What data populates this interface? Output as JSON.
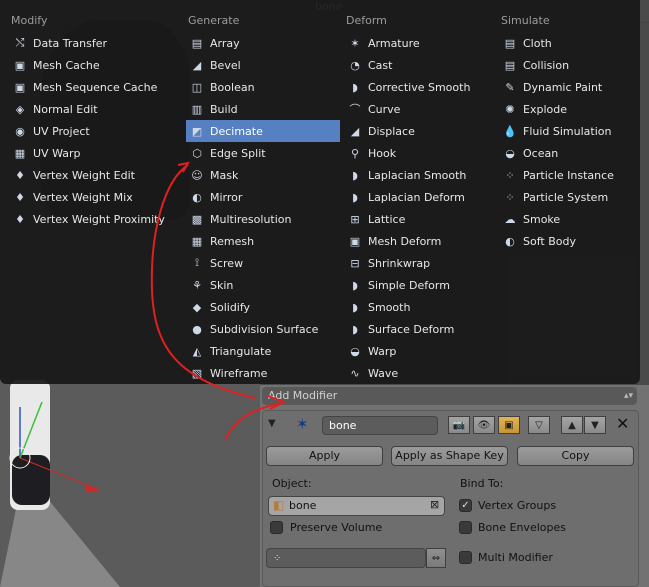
{
  "menu": {
    "columns": [
      {
        "title": "Modify",
        "items": [
          {
            "label": "Data Transfer",
            "icon": "data-transfer-icon",
            "glyph": "⤭"
          },
          {
            "label": "Mesh Cache",
            "icon": "mesh-cache-icon",
            "glyph": "▣"
          },
          {
            "label": "Mesh Sequence Cache",
            "icon": "mesh-sequence-cache-icon",
            "glyph": "▣"
          },
          {
            "label": "Normal Edit",
            "icon": "normal-edit-icon",
            "glyph": "◈"
          },
          {
            "label": "UV Project",
            "icon": "uv-project-icon",
            "glyph": "◉"
          },
          {
            "label": "UV Warp",
            "icon": "uv-warp-icon",
            "glyph": "▦"
          },
          {
            "label": "Vertex Weight Edit",
            "icon": "vertex-weight-edit-icon",
            "glyph": "♦"
          },
          {
            "label": "Vertex Weight Mix",
            "icon": "vertex-weight-mix-icon",
            "glyph": "♦"
          },
          {
            "label": "Vertex Weight Proximity",
            "icon": "vertex-weight-proximity-icon",
            "glyph": "♦"
          }
        ]
      },
      {
        "title": "Generate",
        "items": [
          {
            "label": "Array",
            "icon": "array-icon",
            "glyph": "▤"
          },
          {
            "label": "Bevel",
            "icon": "bevel-icon",
            "glyph": "◢"
          },
          {
            "label": "Boolean",
            "icon": "boolean-icon",
            "glyph": "◫"
          },
          {
            "label": "Build",
            "icon": "build-icon",
            "glyph": "▥"
          },
          {
            "label": "Decimate",
            "icon": "decimate-icon",
            "glyph": "◩",
            "selected": true
          },
          {
            "label": "Edge Split",
            "icon": "edge-split-icon",
            "glyph": "⬡"
          },
          {
            "label": "Mask",
            "icon": "mask-icon",
            "glyph": "☺"
          },
          {
            "label": "Mirror",
            "icon": "mirror-icon",
            "glyph": "◐"
          },
          {
            "label": "Multiresolution",
            "icon": "multiresolution-icon",
            "glyph": "▩"
          },
          {
            "label": "Remesh",
            "icon": "remesh-icon",
            "glyph": "▦"
          },
          {
            "label": "Screw",
            "icon": "screw-icon",
            "glyph": "⟟"
          },
          {
            "label": "Skin",
            "icon": "skin-icon",
            "glyph": "⚘"
          },
          {
            "label": "Solidify",
            "icon": "solidify-icon",
            "glyph": "◆"
          },
          {
            "label": "Subdivision Surface",
            "icon": "subdivision-surface-icon",
            "glyph": "●"
          },
          {
            "label": "Triangulate",
            "icon": "triangulate-icon",
            "glyph": "◭"
          },
          {
            "label": "Wireframe",
            "icon": "wireframe-icon",
            "glyph": "▧"
          }
        ]
      },
      {
        "title": "Deform",
        "items": [
          {
            "label": "Armature",
            "icon": "armature-icon",
            "glyph": "✶"
          },
          {
            "label": "Cast",
            "icon": "cast-icon",
            "glyph": "◔"
          },
          {
            "label": "Corrective Smooth",
            "icon": "corrective-smooth-icon",
            "glyph": "◗"
          },
          {
            "label": "Curve",
            "icon": "curve-icon",
            "glyph": "⌒"
          },
          {
            "label": "Displace",
            "icon": "displace-icon",
            "glyph": "◢"
          },
          {
            "label": "Hook",
            "icon": "hook-icon",
            "glyph": "⚲"
          },
          {
            "label": "Laplacian Smooth",
            "icon": "laplacian-smooth-icon",
            "glyph": "◗"
          },
          {
            "label": "Laplacian Deform",
            "icon": "laplacian-deform-icon",
            "glyph": "◗"
          },
          {
            "label": "Lattice",
            "icon": "lattice-icon",
            "glyph": "⊞"
          },
          {
            "label": "Mesh Deform",
            "icon": "mesh-deform-icon",
            "glyph": "▣"
          },
          {
            "label": "Shrinkwrap",
            "icon": "shrinkwrap-icon",
            "glyph": "⊟"
          },
          {
            "label": "Simple Deform",
            "icon": "simple-deform-icon",
            "glyph": "◗"
          },
          {
            "label": "Smooth",
            "icon": "smooth-icon",
            "glyph": "◗"
          },
          {
            "label": "Surface Deform",
            "icon": "surface-deform-icon",
            "glyph": "◗"
          },
          {
            "label": "Warp",
            "icon": "warp-icon",
            "glyph": "◒"
          },
          {
            "label": "Wave",
            "icon": "wave-icon",
            "glyph": "∿"
          }
        ]
      },
      {
        "title": "Simulate",
        "items": [
          {
            "label": "Cloth",
            "icon": "cloth-icon",
            "glyph": "▤"
          },
          {
            "label": "Collision",
            "icon": "collision-icon",
            "glyph": "▤"
          },
          {
            "label": "Dynamic Paint",
            "icon": "dynamic-paint-icon",
            "glyph": "✎"
          },
          {
            "label": "Explode",
            "icon": "explode-icon",
            "glyph": "✺"
          },
          {
            "label": "Fluid Simulation",
            "icon": "fluid-simulation-icon",
            "glyph": "💧"
          },
          {
            "label": "Ocean",
            "icon": "ocean-icon",
            "glyph": "◒"
          },
          {
            "label": "Particle Instance",
            "icon": "particle-instance-icon",
            "glyph": "⁘"
          },
          {
            "label": "Particle System",
            "icon": "particle-system-icon",
            "glyph": "⁘"
          },
          {
            "label": "Smoke",
            "icon": "smoke-icon",
            "glyph": "☁"
          },
          {
            "label": "Soft Body",
            "icon": "soft-body-icon",
            "glyph": "◐"
          }
        ]
      }
    ]
  },
  "properties": {
    "add_modifier_label": "Add Modifier",
    "modifier_name": "bone",
    "apply_label": "Apply",
    "apply_shape_key_label": "Apply as Shape Key",
    "copy_label": "Copy",
    "object_label": "Object:",
    "object_value": "bone",
    "bind_to_label": "Bind To:",
    "vertex_groups_label": "Vertex Groups",
    "bone_envelopes_label": "Bone Envelopes",
    "preserve_volume_label": "Preserve Volume",
    "multi_modifier_label": "Multi Modifier",
    "vertex_groups_checked": true
  },
  "outliner": {
    "top_item": "bone"
  },
  "colors": {
    "selection": "#5680c2",
    "annotation": "#e02020"
  }
}
